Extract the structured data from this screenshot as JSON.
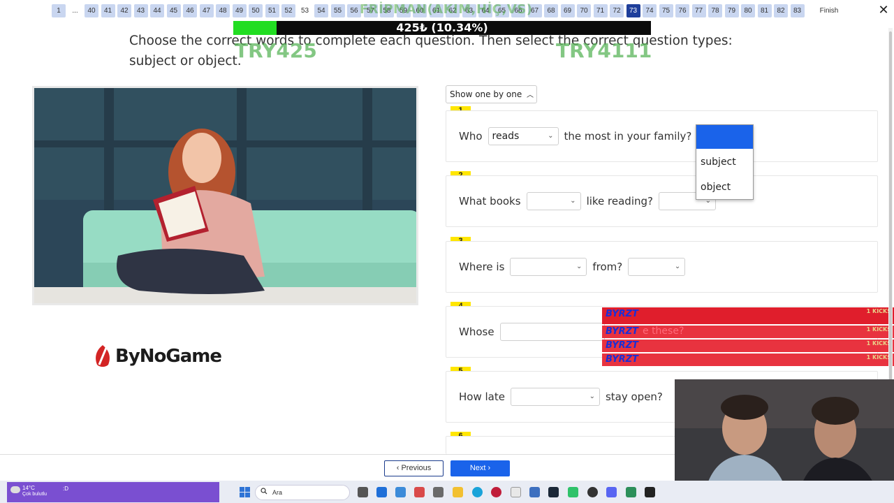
{
  "nav": {
    "pages": [
      "1",
      "...",
      "40",
      "41",
      "42",
      "43",
      "44",
      "45",
      "46",
      "47",
      "48",
      "49",
      "50",
      "51",
      "52",
      "53",
      "54",
      "55",
      "56",
      "57",
      "58",
      "59",
      "60",
      "61",
      "62",
      "63",
      "64",
      "65",
      "66",
      "67",
      "68",
      "69",
      "70",
      "71",
      "72",
      "73",
      "74",
      "75",
      "76",
      "77",
      "78",
      "79",
      "80",
      "81",
      "82",
      "83"
    ],
    "current_page": "73",
    "finish_label": "Finish",
    "close_label": "✕"
  },
  "overlay": {
    "donor_title": "FRİPMAN(AKIM,HİÇ,VS)",
    "goal_text": "425₺ (10.34%)",
    "goal_percent": 10.34,
    "code_left": "TRY425",
    "code_right": "TRY4111",
    "kicks": [
      {
        "name": "BYRZT",
        "amount": "1 KICKS"
      },
      {
        "name": "BYRZT",
        "amount": "1 KICKS"
      },
      {
        "name": "BYRZT",
        "amount": "1 KICKS"
      },
      {
        "name": "BYRZT",
        "amount": "1 KICKS"
      }
    ]
  },
  "instruction": "Choose the correct words to complete each question. Then select the correct question types: subject or object.",
  "logo_text": "ByNoGame",
  "show_toggle": "Show one by one",
  "questions": [
    {
      "num": "1",
      "part1": "Who",
      "select1": "reads",
      "part2": "the most in your family?"
    },
    {
      "num": "2",
      "part1": "What books",
      "select1": "",
      "part2": "like reading?"
    },
    {
      "num": "3",
      "part1": "Where is",
      "select1": "",
      "part2": "from?"
    },
    {
      "num": "4",
      "part1": "Whose",
      "select1": "",
      "part2": "e these?"
    },
    {
      "num": "5",
      "part1": "How late",
      "select1": "",
      "part2": "stay open?"
    },
    {
      "num": "6"
    }
  ],
  "dropdown": {
    "options": [
      "subject",
      "object"
    ]
  },
  "buttons": {
    "previous": "Previous",
    "next": "Next"
  },
  "taskbar": {
    "temp": "14°C",
    "condition": "Çok bulutlu",
    "extra": ":D",
    "search": "Ara"
  },
  "colors": {
    "accent": "#1a63ea",
    "nav_current": "#1f3f9b",
    "question_badge": "#ffe600",
    "kick_row": "#e8333f"
  }
}
